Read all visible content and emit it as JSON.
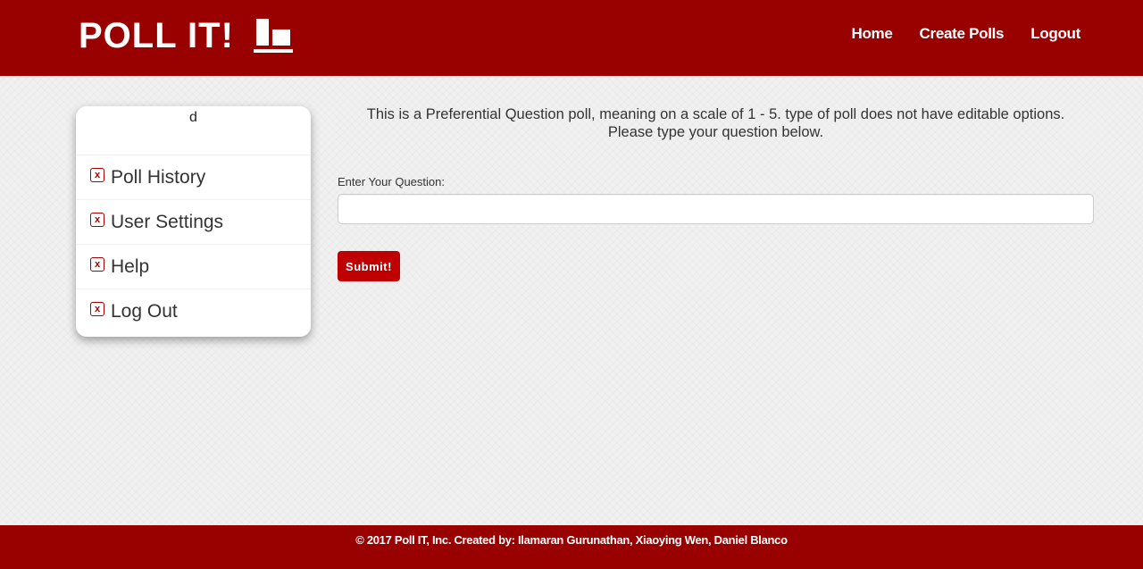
{
  "header": {
    "brand": "POLL IT!",
    "brand_icon": "bar-chart-icon",
    "nav": [
      "Home",
      "Create Polls",
      "Logout"
    ]
  },
  "sidebar": {
    "username": "d",
    "items": [
      {
        "icon": "x-box-icon",
        "label": "Poll History"
      },
      {
        "icon": "x-box-icon",
        "label": "User Settings"
      },
      {
        "icon": "x-box-icon",
        "label": "Help"
      },
      {
        "icon": "x-box-icon",
        "label": "Log Out"
      }
    ]
  },
  "main": {
    "description_line1": "This is a Preferential Question poll, meaning on a scale of 1 - 5. type of poll does not have editable options.",
    "description_line2": "Please type your question below.",
    "question_label": "Enter Your Question:",
    "question_value": "",
    "question_placeholder": "",
    "submit_label": "Submit!"
  },
  "footer": {
    "text": "© 2017 Poll IT, Inc. Created by: Ilamaran Gurunathan, Xiaoying Wen, Daniel Blanco"
  },
  "colors": {
    "brand_red": "#990000",
    "button_red": "#c00000",
    "icon_red": "#aa0000"
  }
}
